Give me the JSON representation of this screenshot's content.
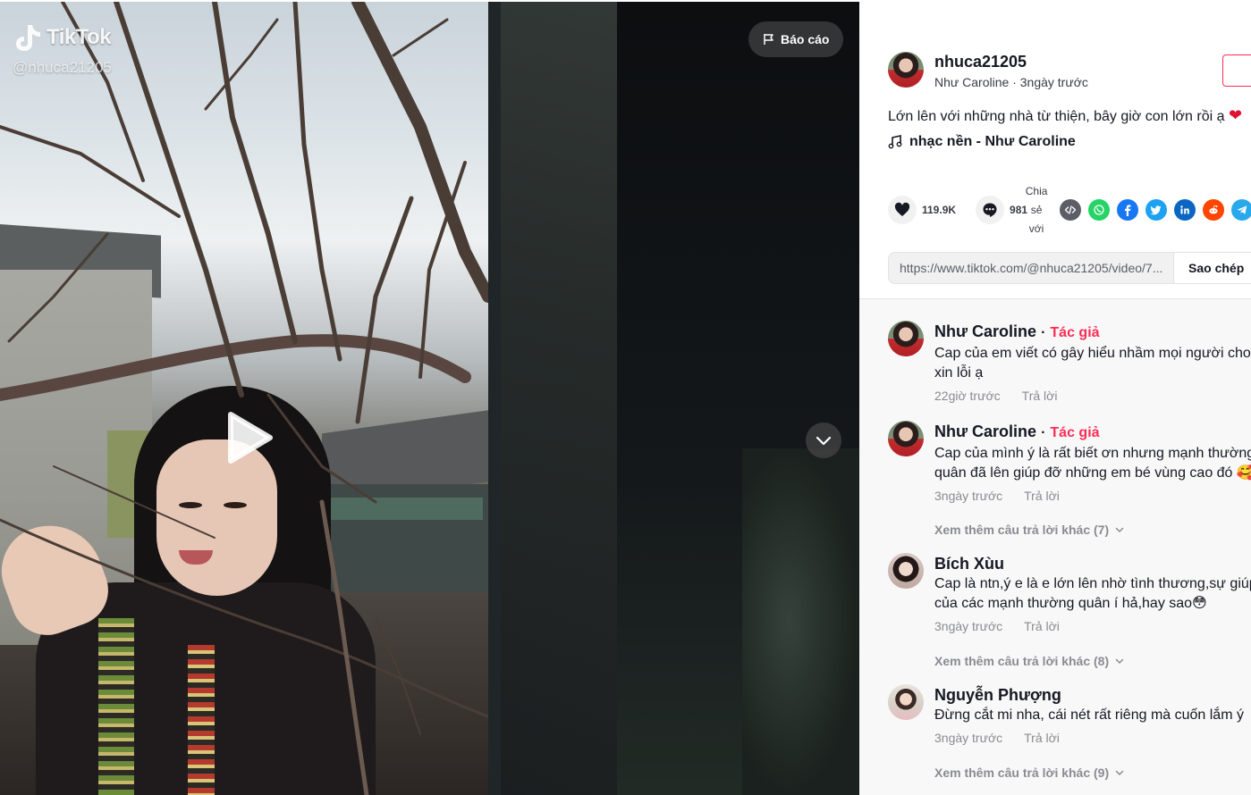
{
  "video": {
    "watermark_brand": "TikTok",
    "watermark_handle": "@nhuca21205",
    "report_label": "Báo cáo"
  },
  "post": {
    "username": "nhuca21205",
    "display_name": "Như Caroline",
    "posted_ago": "3ngày trước",
    "caption": "Lớn lên với những nhà từ thiện, bây giờ con lớn rồi ạ",
    "caption_emoji": "❤",
    "music": "nhạc nền - Như Caroline"
  },
  "actions": {
    "likes": "119.9K",
    "comments": "981",
    "share_label_lines": [
      "Chia",
      "sẻ",
      "với"
    ]
  },
  "share_icons": [
    {
      "name": "embed-icon",
      "color": "#5c5e66"
    },
    {
      "name": "whatsapp-icon",
      "color": "#25d366"
    },
    {
      "name": "facebook-icon",
      "color": "#1877f2"
    },
    {
      "name": "twitter-icon",
      "color": "#1da1f2"
    },
    {
      "name": "linkedin-icon",
      "color": "#0a66c2"
    },
    {
      "name": "reddit-icon",
      "color": "#ff4500"
    },
    {
      "name": "telegram-icon",
      "color": "#29a9eb"
    }
  ],
  "link": {
    "url": "https://www.tiktok.com/@nhuca21205/video/7...",
    "copy_label": "Sao chép"
  },
  "comments": [
    {
      "author": "Như Caroline",
      "separator": "·",
      "tag": "Tác giả",
      "lines": [
        "Cap của em viết có gây hiểu nhầm mọi người cho e",
        "xin lỗi ạ"
      ],
      "time": "22giờ trước",
      "reply_label": "Trả lời",
      "more": ""
    },
    {
      "author": "Như Caroline",
      "separator": "·",
      "tag": "Tác giả",
      "lines": [
        "Cap của mình ý là rất biết ơn nhưng mạnh thường",
        "quân đã lên giúp đỡ những em bé vùng cao đó 🥰"
      ],
      "time": "3ngày trước",
      "reply_label": "Trả lời",
      "more": "Xem thêm câu trả lời khác (7)"
    },
    {
      "author": "Bích Xùu",
      "separator": "",
      "tag": "",
      "lines": [
        "Cap là ntn,ý e là e lớn lên nhờ tình thương,sự giúp",
        "của các mạnh thường quân í hả,hay sao😳"
      ],
      "time": "3ngày trước",
      "reply_label": "Trả lời",
      "more": "Xem thêm câu trả lời khác (8)"
    },
    {
      "author": "Nguyễn Phượng",
      "separator": "",
      "tag": "",
      "lines": [
        "Đừng cắt mi nha, cái nét rất riêng mà cuốn lắm ý"
      ],
      "time": "3ngày trước",
      "reply_label": "Trả lời",
      "more": "Xem thêm câu trả lời khác (9)"
    }
  ]
}
